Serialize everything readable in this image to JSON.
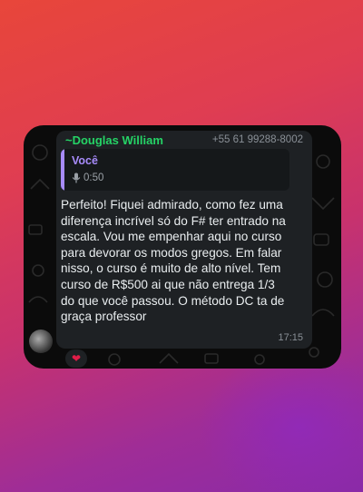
{
  "message": {
    "sender_name": "~Douglas William",
    "sender_phone": "+55 61 99288-8002",
    "quote_author": "Você",
    "quote_duration": "0:50",
    "quote_icon": "microphone-icon",
    "text": "Perfeito! Fiquei admirado, como fez uma diferença incrível só do F# ter entrado na escala. Vou me empenhar aqui no curso para devorar os modos gregos. Em falar nisso, o curso é muito de alto nível. Tem curso de R$500 ai que não entrega 1/3 do que você passou. O método DC ta de graça professor",
    "time": "17:15",
    "reaction": "❤"
  },
  "colors": {
    "sender": "#25d366",
    "quote_accent": "#a78bfa",
    "bubble": "#1e2124",
    "text": "#e9edef",
    "muted": "#8a9097"
  }
}
